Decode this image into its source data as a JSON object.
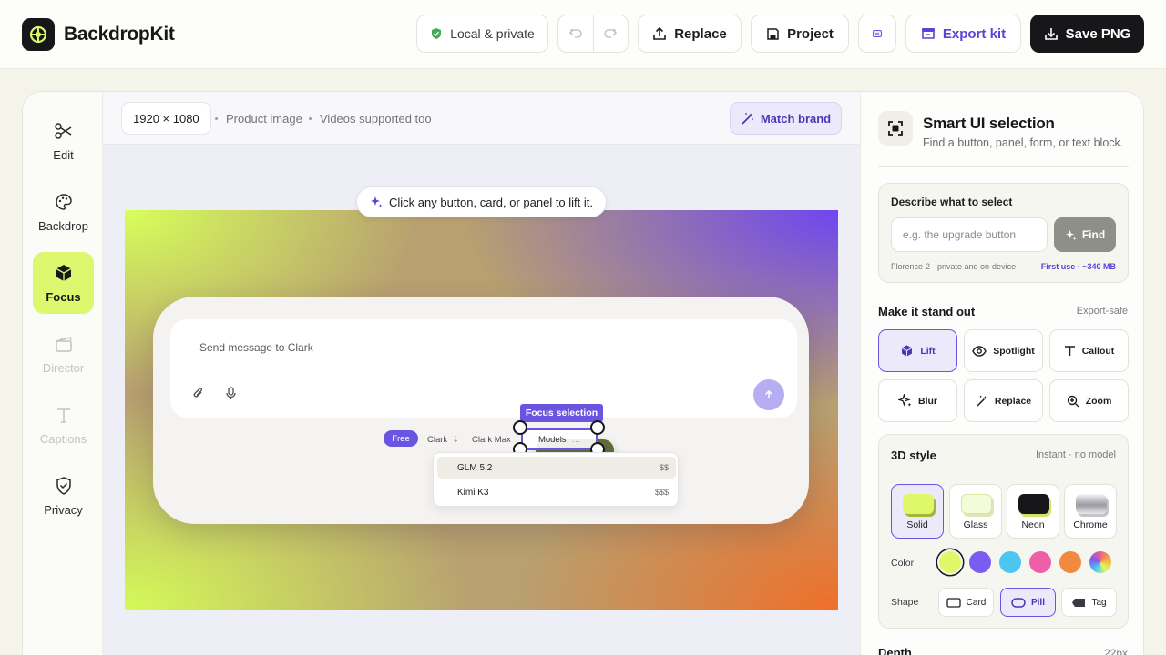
{
  "app": {
    "name": "BackdropKit"
  },
  "toolbar": {
    "privacy_label": "Local & private",
    "replace_label": "Replace",
    "project_label": "Project",
    "export_label": "Export kit",
    "save_label": "Save PNG"
  },
  "rail": {
    "items": [
      {
        "label": "Edit",
        "icon": "scissors-icon",
        "state": "normal"
      },
      {
        "label": "Backdrop",
        "icon": "palette-icon",
        "state": "normal"
      },
      {
        "label": "Focus",
        "icon": "cube-icon",
        "state": "active"
      },
      {
        "label": "Director",
        "icon": "clapperboard-icon",
        "state": "disabled"
      },
      {
        "label": "Captions",
        "icon": "text-icon",
        "state": "disabled"
      },
      {
        "label": "Privacy",
        "icon": "shield-check-icon",
        "state": "normal"
      }
    ]
  },
  "canvas": {
    "dimensions": "1920 × 1080",
    "meta1": "Product image",
    "meta2": "Videos supported too",
    "match_brand": "Match brand",
    "hint": "Click any button, card, or panel to lift it.",
    "preview": {
      "placeholder": "Send message to Clark",
      "tiers": [
        "Free",
        "Clark",
        "Clark Max"
      ],
      "models_label": "Models",
      "selection_label": "Focus selection",
      "models": [
        {
          "name": "GLM 5.2",
          "price": "$$"
        },
        {
          "name": "Kimi K3",
          "price": "$$$"
        }
      ]
    }
  },
  "panel": {
    "title": "Smart UI selection",
    "subtitle": "Find a button, panel, form, or text block.",
    "describe": {
      "label": "Describe what to select",
      "placeholder": "e.g. the upgrade button",
      "find_label": "Find",
      "note": "Florence-2 · private and on-device",
      "first_use": "First use · ~340 MB"
    },
    "stand_out": {
      "title": "Make it stand out",
      "note": "Export-safe",
      "effects": [
        {
          "label": "Lift",
          "icon": "cube-icon",
          "active": true
        },
        {
          "label": "Spotlight",
          "icon": "eye-icon",
          "active": false
        },
        {
          "label": "Callout",
          "icon": "text-icon",
          "active": false
        },
        {
          "label": "Blur",
          "icon": "sparkle-icon",
          "active": false
        },
        {
          "label": "Replace",
          "icon": "wand-icon",
          "active": false
        },
        {
          "label": "Zoom",
          "icon": "zoom-icon",
          "active": false
        }
      ]
    },
    "style3d": {
      "title": "3D style",
      "note": "Instant · no model",
      "styles": [
        {
          "label": "Solid",
          "active": true
        },
        {
          "label": "Glass",
          "active": false
        },
        {
          "label": "Neon",
          "active": false
        },
        {
          "label": "Chrome",
          "active": false
        }
      ],
      "color_label": "Color",
      "colors": [
        "#dff86a",
        "#7a5cf0",
        "#4cc6f0",
        "#ef5fa8",
        "#f08a3e",
        "rainbow"
      ],
      "shape_label": "Shape",
      "shapes": [
        {
          "label": "Card",
          "active": false
        },
        {
          "label": "Pill",
          "active": true
        },
        {
          "label": "Tag",
          "active": false
        }
      ]
    },
    "depth": {
      "label": "Depth",
      "value": "22px"
    }
  }
}
